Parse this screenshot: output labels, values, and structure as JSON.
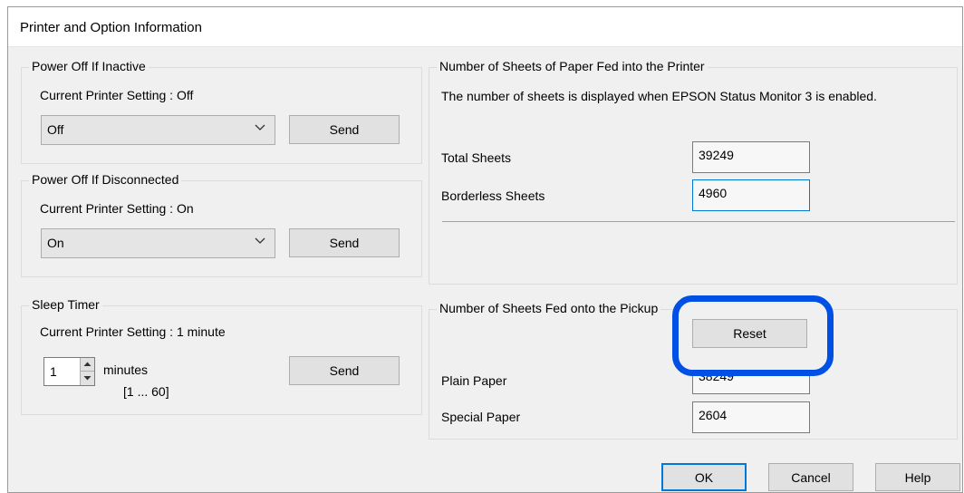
{
  "window": {
    "title": "Printer and Option Information"
  },
  "power_off_inactive": {
    "legend": "Power Off If Inactive",
    "current": "Current Printer Setting : Off",
    "selected": "Off",
    "send_label": "Send"
  },
  "power_off_disconnected": {
    "legend": "Power Off If Disconnected",
    "current": "Current Printer Setting : On",
    "selected": "On",
    "send_label": "Send"
  },
  "sleep_timer": {
    "legend": "Sleep Timer",
    "current": "Current Printer Setting : 1 minute",
    "value": "1",
    "unit": "minutes",
    "range": "[1 ... 60]",
    "send_label": "Send"
  },
  "sheets_fed_printer": {
    "legend": "Number of Sheets of Paper Fed into the Printer",
    "note": "The number of sheets is displayed when EPSON Status Monitor 3 is enabled.",
    "total_label": "Total Sheets",
    "total_value": "39249",
    "borderless_label": "Borderless Sheets",
    "borderless_value": "4960"
  },
  "sheets_fed_pickup": {
    "legend": "Number of Sheets Fed onto the Pickup",
    "reset_label": "Reset",
    "plain_label": "Plain Paper",
    "plain_value": "38249",
    "special_label": "Special Paper",
    "special_value": "2604",
    "highlight_color": "#0050e6"
  },
  "footer": {
    "ok_label": "OK",
    "cancel_label": "Cancel",
    "help_label": "Help"
  },
  "icons": {
    "dropdown": "chevron-down-icon",
    "spinner_up": "arrow-up-icon",
    "spinner_down": "arrow-down-icon"
  }
}
